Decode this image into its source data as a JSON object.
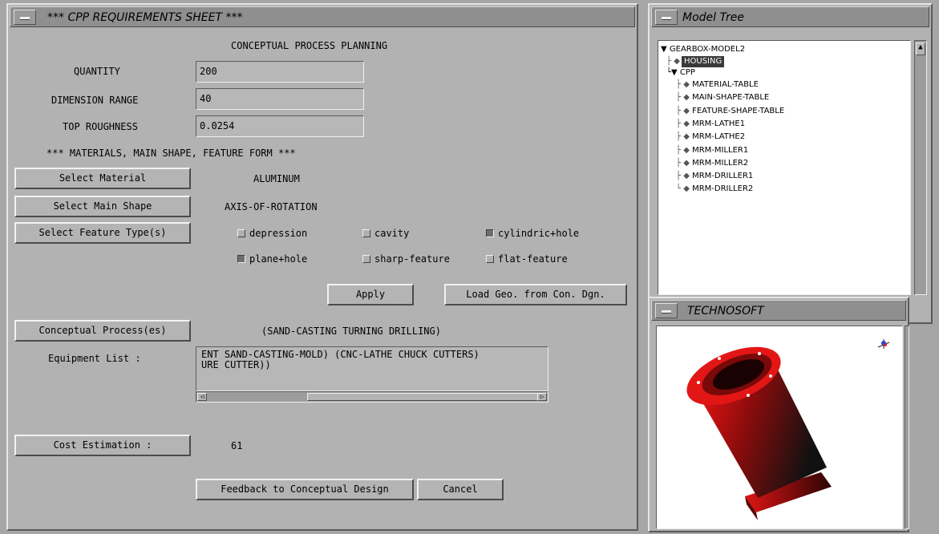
{
  "cpp_window": {
    "title": "*** CPP REQUIREMENTS SHEET ***",
    "heading": "CONCEPTUAL PROCESS PLANNING",
    "quantity_label": "QUANTITY",
    "quantity_value": "200",
    "dimension_label": "DIMENSION RANGE",
    "dimension_value": "40",
    "roughness_label": "TOP ROUGHNESS",
    "roughness_value": "0.0254",
    "section_heading": "*** MATERIALS, MAIN SHAPE, FEATURE FORM ***",
    "select_material_label": "Select Material",
    "material_value": "ALUMINUM",
    "select_main_shape_label": "Select Main Shape",
    "main_shape_value": "AXIS-OF-ROTATION",
    "select_feature_label": "Select Feature Type(s)",
    "features": [
      {
        "label": "depression",
        "checked": false
      },
      {
        "label": "cavity",
        "checked": false
      },
      {
        "label": "cylindric+hole",
        "checked": true
      },
      {
        "label": "plane+hole",
        "checked": true
      },
      {
        "label": "sharp-feature",
        "checked": false
      },
      {
        "label": "flat-feature",
        "checked": false
      }
    ],
    "apply_label": "Apply",
    "load_geo_label": "Load Geo. from Con. Dgn.",
    "conceptual_process_label": "Conceptual Process(es)",
    "conceptual_process_value": "(SAND-CASTING TURNING DRILLING)",
    "equipment_label": "Equipment List :",
    "equipment_text": "ENT SAND-CASTING-MOLD) (CNC-LATHE CHUCK CUTTERS)\nURE CUTTER))",
    "cost_label": "Cost Estimation :",
    "cost_value": "61",
    "feedback_label": "Feedback to Conceptual Design",
    "cancel_label": "Cancel"
  },
  "model_tree": {
    "title": "Model Tree",
    "root": "GEARBOX-MODEL2",
    "housing": "HOUSING",
    "cpp": "CPP",
    "children": [
      "MATERIAL-TABLE",
      "MAIN-SHAPE-TABLE",
      "FEATURE-SHAPE-TABLE",
      "MRM-LATHE1",
      "MRM-LATHE2",
      "MRM-MILLER1",
      "MRM-MILLER2",
      "MRM-DRILLER1",
      "MRM-DRILLER2"
    ]
  },
  "viewer": {
    "title": "TECHNOSOFT",
    "part_color": "#e0141a"
  }
}
